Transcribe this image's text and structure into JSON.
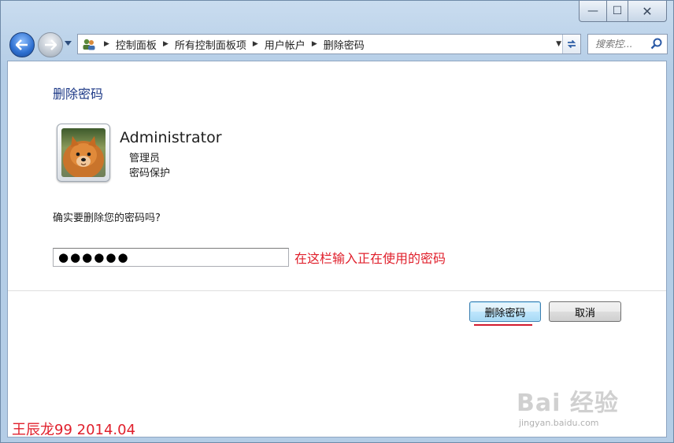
{
  "window": {
    "buttons": {
      "minimize": "—",
      "maximize": "☐",
      "close": "✕"
    }
  },
  "navigation": {
    "breadcrumbs": [
      "控制面板",
      "所有控制面板项",
      "用户帐户",
      "删除密码"
    ],
    "search_placeholder": "搜索控..."
  },
  "page": {
    "title": "删除密码",
    "user": {
      "name": "Administrator",
      "role": "管理员",
      "status": "密码保护"
    },
    "question": "确实要删除您的密码吗?",
    "password_value": "●●●●●●",
    "annotation": "在这栏输入正在使用的密码",
    "buttons": {
      "delete": "删除密码",
      "cancel": "取消"
    }
  },
  "watermarks": {
    "author": "王辰龙99 2014.04",
    "baidu_logo": "Bai 经验",
    "baidu_url": "jingyan.baidu.com"
  },
  "colors": {
    "title": "#1e3a87",
    "annotation": "#e0202c",
    "underline": "#d21b2f"
  }
}
